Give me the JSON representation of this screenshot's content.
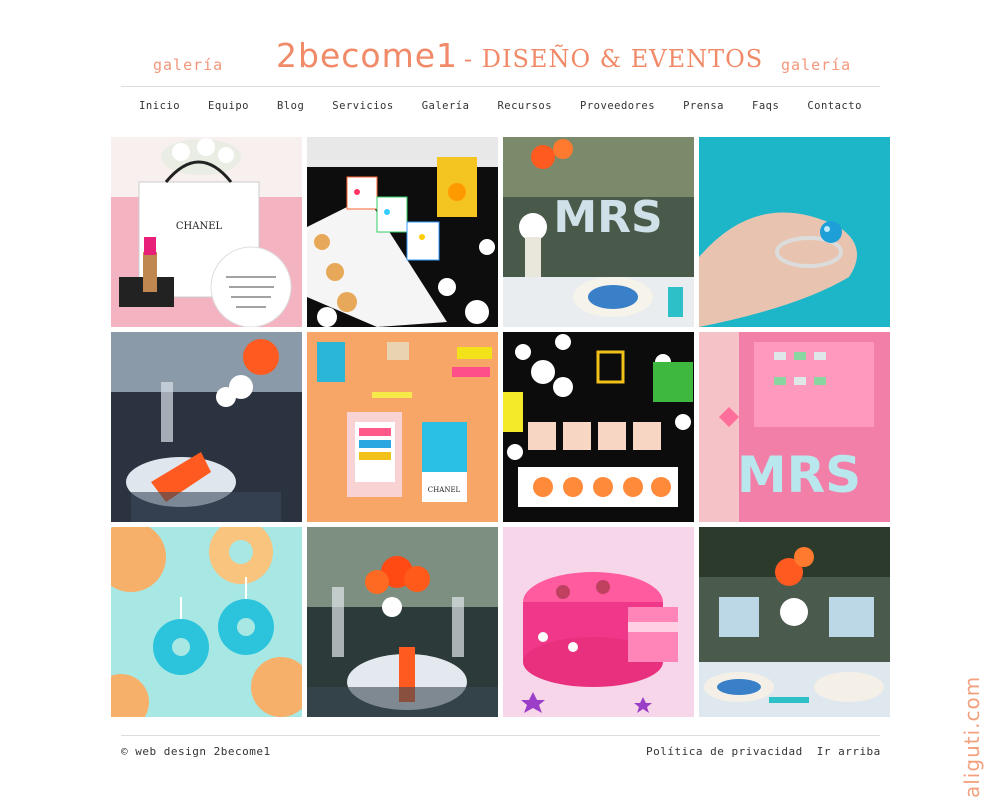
{
  "header": {
    "left_label": "galería",
    "right_label": "galería",
    "brand_name": "2become1",
    "brand_sub": "- DISEÑO & EVENTOS"
  },
  "nav": [
    "Inicio",
    "Equipo",
    "Blog",
    "Servicios",
    "Galería",
    "Recursos",
    "Proveedores",
    "Prensa",
    "Faqs",
    "Contacto"
  ],
  "gallery": [
    {
      "name": "chanel-bag-lipstick-photo",
      "text": "CHANEL"
    },
    {
      "name": "popcorn-boxes-table-photo"
    },
    {
      "name": "mrs-letters-table-photo",
      "text": "MRS"
    },
    {
      "name": "ring-on-finger-photo"
    },
    {
      "name": "table-setting-orange-napkin-photo"
    },
    {
      "name": "flatlay-orange-chanel-photo",
      "text": "CHANEL"
    },
    {
      "name": "polka-dot-desserts-photo"
    },
    {
      "name": "pink-mrs-letters-photo",
      "text": "MRS"
    },
    {
      "name": "donut-earrings-photo"
    },
    {
      "name": "gerbera-table-setting-photo"
    },
    {
      "name": "pink-cake-photo"
    },
    {
      "name": "mr-mrs-table-photo"
    }
  ],
  "footer": {
    "credit": "© web design 2become1",
    "privacy": "Política de privacidad",
    "top": "Ir arriba"
  },
  "watermark": "aliguti.com"
}
